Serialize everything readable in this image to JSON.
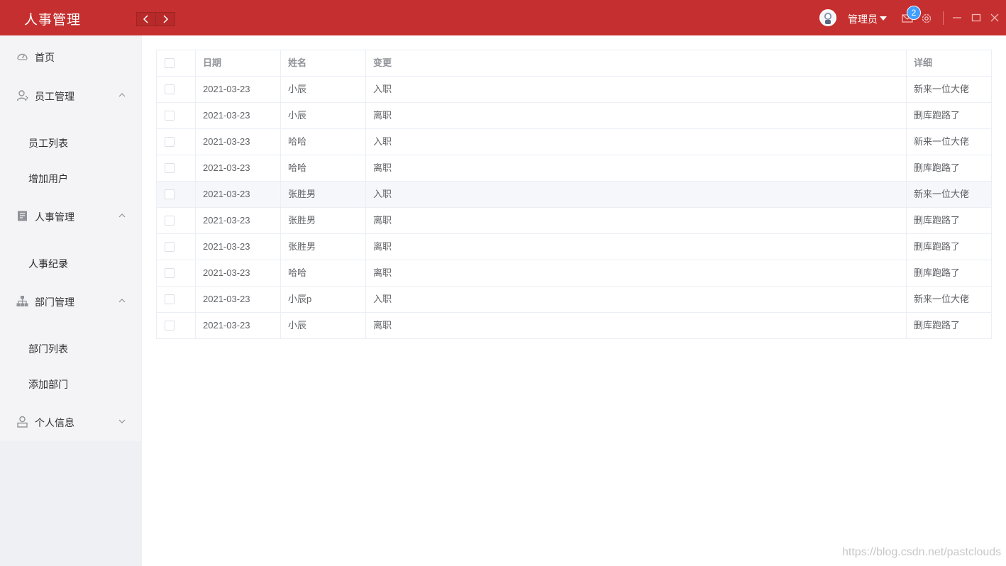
{
  "header": {
    "title": "人事管理",
    "user_name": "管理员",
    "notification_count": "2",
    "accent_color": "#c62f2f"
  },
  "sidebar": {
    "home": "首页",
    "groups": [
      {
        "label": "员工管理",
        "icon": "user-icon",
        "expanded": true,
        "items": [
          "员工列表",
          "增加用户"
        ]
      },
      {
        "label": "人事管理",
        "icon": "document-icon",
        "expanded": true,
        "items": [
          "人事纪录"
        ]
      },
      {
        "label": "部门管理",
        "icon": "org-chart-icon",
        "expanded": true,
        "items": [
          "部门列表",
          "添加部门"
        ]
      },
      {
        "label": "个人信息",
        "icon": "person-icon",
        "expanded": false,
        "items": []
      }
    ]
  },
  "table": {
    "columns": [
      "日期",
      "姓名",
      "变更",
      "详细"
    ],
    "rows": [
      [
        "2021-03-23",
        "小辰",
        "入职",
        "新来一位大佬"
      ],
      [
        "2021-03-23",
        "小辰",
        "离职",
        "删库跑路了"
      ],
      [
        "2021-03-23",
        "哈哈",
        "入职",
        "新来一位大佬"
      ],
      [
        "2021-03-23",
        "哈哈",
        "离职",
        "删库跑路了"
      ],
      [
        "2021-03-23",
        "张胜男",
        "入职",
        "新来一位大佬"
      ],
      [
        "2021-03-23",
        "张胜男",
        "离职",
        "删库跑路了"
      ],
      [
        "2021-03-23",
        "张胜男",
        "离职",
        "删库跑路了"
      ],
      [
        "2021-03-23",
        "哈哈",
        "离职",
        "删库跑路了"
      ],
      [
        "2021-03-23",
        "小辰p",
        "入职",
        "新来一位大佬"
      ],
      [
        "2021-03-23",
        "小辰",
        "离职",
        "删库跑路了"
      ]
    ]
  },
  "watermark": "https://blog.csdn.net/pastclouds"
}
